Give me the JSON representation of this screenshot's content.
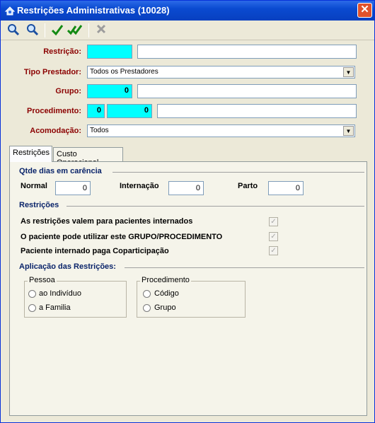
{
  "window": {
    "title": "Restrições Administrativas (10028)",
    "close_glyph": "✕"
  },
  "toolbar": {
    "search": "search-icon",
    "search2": "search-plus-icon",
    "confirm": "check-icon",
    "confirm_all": "double-check-icon",
    "cancel": "x-icon"
  },
  "form": {
    "restricao_label": "Restrição:",
    "restricao_value": "",
    "tipo_prestador_label": "Tipo Prestador:",
    "tipo_prestador_value": "Todos os Prestadores",
    "grupo_label": "Grupo:",
    "grupo_value": "0",
    "procedimento_label": "Procedimento:",
    "procedimento_value1": "0",
    "procedimento_value2": "0",
    "acomodacao_label": "Acomodação:",
    "acomodacao_value": "Todos"
  },
  "tabs": [
    {
      "label": "Restrições"
    },
    {
      "label": "Custo Operacional"
    }
  ],
  "carencia": {
    "title": "Qtde dias em carência",
    "normal_label": "Normal",
    "normal_value": "0",
    "internacao_label": "Internação",
    "internacao_value": "0",
    "parto_label": "Parto",
    "parto_value": "0"
  },
  "restricoes": {
    "title": "Restrições",
    "items": [
      {
        "label": "As restrições valem para pacientes internados",
        "checked": true
      },
      {
        "label": "O paciente pode utilizar este GRUPO/PROCEDIMENTO",
        "checked": true
      },
      {
        "label": "Paciente internado paga Coparticipação",
        "checked": true
      }
    ]
  },
  "aplicacao": {
    "title": "Aplicação das Restrições:",
    "pessoa": {
      "title": "Pessoa",
      "options": [
        "ao Indivíduo",
        "a Familia"
      ]
    },
    "procedimento": {
      "title": "Procedimento",
      "options": [
        "Código",
        "Grupo"
      ]
    }
  },
  "colors": {
    "title_bar": "#0a4ad0",
    "label_red": "#8b0000",
    "section_blue": "#0a246a",
    "cyan_field": "#00ffff"
  }
}
